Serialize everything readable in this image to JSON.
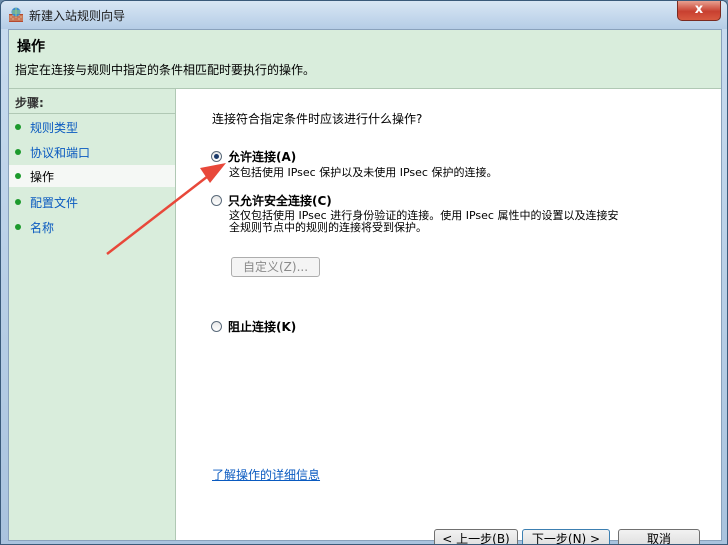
{
  "window": {
    "title": "新建入站规则向导",
    "close_label": "x"
  },
  "header": {
    "title": "操作",
    "description": "指定在连接与规则中指定的条件相匹配时要执行的操作。"
  },
  "sidebar": {
    "steps_label": "步骤:",
    "items": [
      {
        "label": "规则类型"
      },
      {
        "label": "协议和端口"
      },
      {
        "label": "操作"
      },
      {
        "label": "配置文件"
      },
      {
        "label": "名称"
      }
    ],
    "current_index": 2
  },
  "main": {
    "question": "连接符合指定条件时应该进行什么操作?",
    "options": [
      {
        "title": "允许连接(A)",
        "desc": [
          "这包括使用 IPsec 保护以及未使用 IPsec 保护的连接。"
        ],
        "selected": true
      },
      {
        "title": "只允许安全连接(C)",
        "desc": [
          "这仅包括使用 IPsec 进行身份验证的连接。使用 IPsec 属性中的设置以及连接安",
          "全规则节点中的规则的连接将受到保护。"
        ],
        "selected": false
      },
      {
        "title": "阻止连接(K)",
        "desc": [],
        "selected": false
      }
    ],
    "customize_button": "自定义(Z)...",
    "learn_more_link": "了解操作的详细信息"
  },
  "buttons": {
    "back": "< 上一步(B)",
    "next": "下一步(N) >",
    "cancel": "取消"
  },
  "colors": {
    "header_bg": "#d9eddc",
    "link": "#0a5ac0",
    "step_dot": "#1c9a2c",
    "annotation_arrow": "#e8483a"
  }
}
